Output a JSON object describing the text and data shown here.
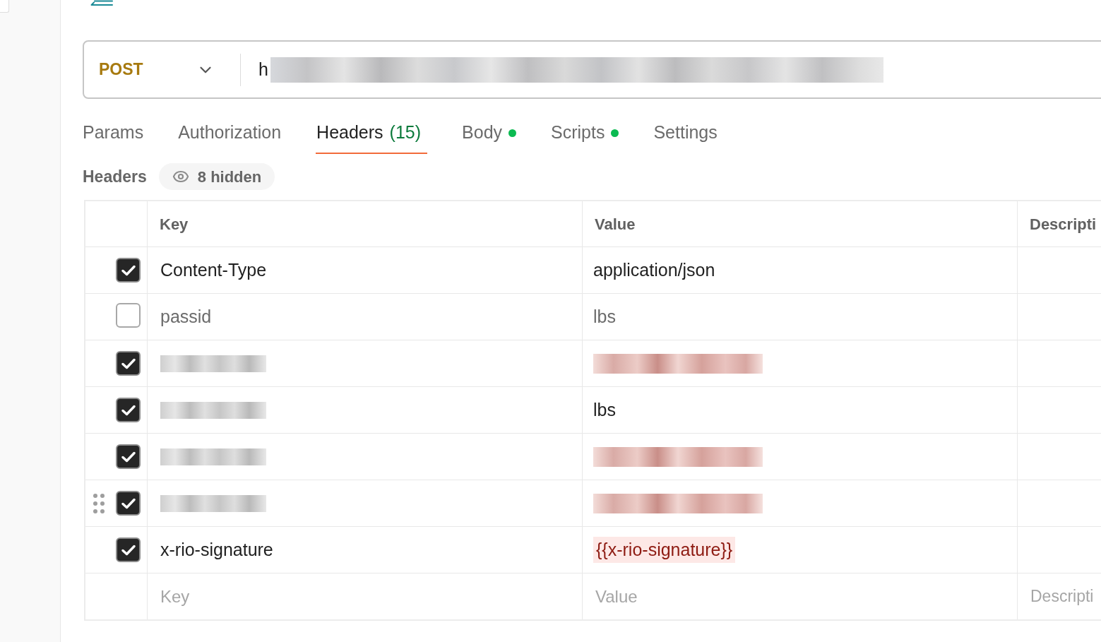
{
  "request": {
    "method": "POST",
    "url": {
      "value": "h",
      "redacted": true
    }
  },
  "tabs": [
    {
      "label": "Params",
      "indicator": false,
      "selected": false
    },
    {
      "label": "Authorization",
      "indicator": false,
      "selected": false
    },
    {
      "label": "Headers",
      "count": "(15)",
      "indicator": false,
      "selected": true
    },
    {
      "label": "Body",
      "indicator": true,
      "selected": false
    },
    {
      "label": "Scripts",
      "indicator": true,
      "selected": false
    },
    {
      "label": "Settings",
      "indicator": false,
      "selected": false
    }
  ],
  "headers_section": {
    "title": "Headers",
    "hidden_toggle": {
      "label": "8 hidden"
    }
  },
  "table": {
    "columns": [
      "Key",
      "Value",
      "Descripti"
    ],
    "rows": [
      {
        "enabled": true,
        "drag_handle": false,
        "key": "Content-Type",
        "key_redacted": false,
        "value": {
          "kind": "text",
          "text": "application/json",
          "redacted": false
        }
      },
      {
        "enabled": false,
        "drag_handle": false,
        "key": "passid",
        "key_redacted": false,
        "value": {
          "kind": "text",
          "text": "lbs",
          "redacted": false
        }
      },
      {
        "enabled": true,
        "drag_handle": false,
        "key_redacted": true,
        "value": {
          "kind": "variable",
          "redacted": true
        }
      },
      {
        "enabled": true,
        "drag_handle": false,
        "key_redacted": true,
        "value": {
          "kind": "text",
          "text": "lbs",
          "redacted": false
        }
      },
      {
        "enabled": true,
        "drag_handle": false,
        "key_redacted": true,
        "value": {
          "kind": "variable",
          "redacted": true
        }
      },
      {
        "enabled": true,
        "drag_handle": true,
        "key_redacted": true,
        "value": {
          "kind": "variable",
          "redacted": true
        }
      },
      {
        "enabled": true,
        "drag_handle": false,
        "key": "x-rio-signature",
        "key_redacted": false,
        "value": {
          "kind": "variable",
          "text": "{{x-rio-signature}}",
          "redacted": false
        }
      }
    ],
    "new_row": {
      "key_placeholder": "Key",
      "value_placeholder": "Value",
      "description_placeholder": "Descripti"
    }
  }
}
